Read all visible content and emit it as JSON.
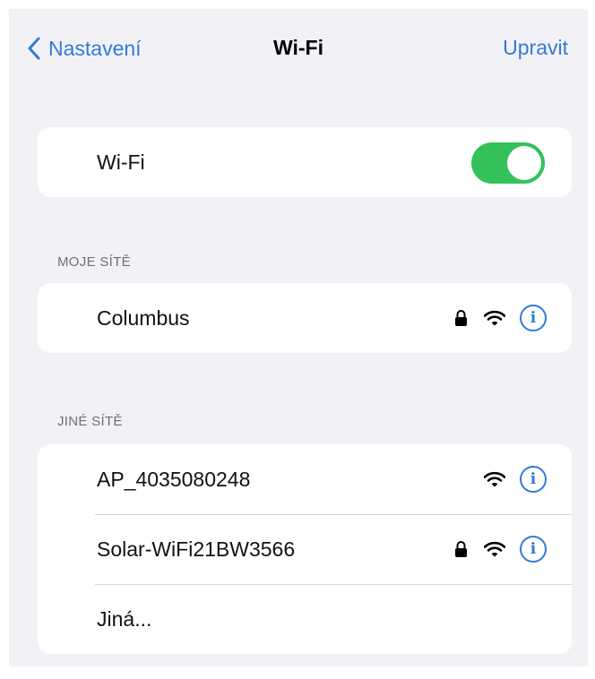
{
  "nav": {
    "back_label": "Nastavení",
    "title": "Wi-Fi",
    "edit_label": "Upravit"
  },
  "wifi_toggle": {
    "label": "Wi-Fi",
    "on": true
  },
  "my_networks": {
    "header": "MOJE SÍTĚ",
    "items": [
      {
        "name": "Columbus",
        "locked": true
      }
    ]
  },
  "other_networks": {
    "header": "JINÉ SÍTĚ",
    "items": [
      {
        "name": "AP_4035080248",
        "locked": false
      },
      {
        "name": "Solar-WiFi21BW3566",
        "locked": true
      }
    ],
    "other_label": "Jiná..."
  },
  "info_glyph": "i",
  "colors": {
    "accent": "#2f7bd9",
    "toggle_on": "#34c15a",
    "background": "#f2f2f6"
  },
  "icons": [
    "chevron-left-icon",
    "lock-icon",
    "wifi-icon",
    "info-icon"
  ]
}
